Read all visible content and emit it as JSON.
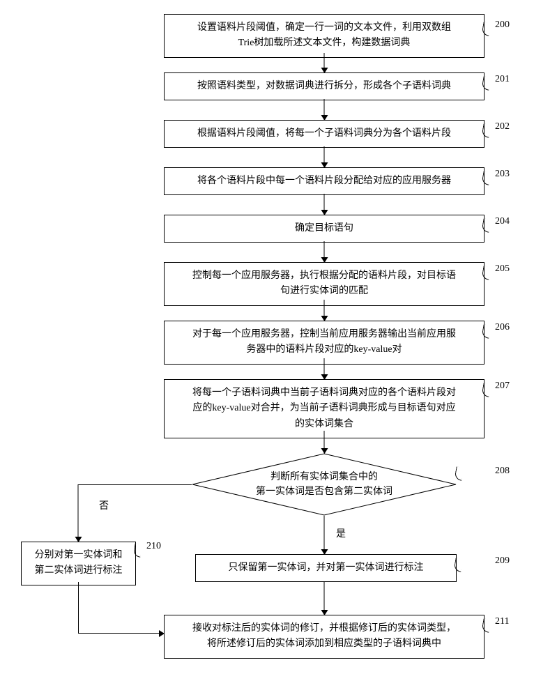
{
  "steps": {
    "s200": {
      "num": "200",
      "text": "设置语料片段阈值，确定一行一词的文本文件，利用双数组\nTrie树加载所述文本文件，构建数据词典"
    },
    "s201": {
      "num": "201",
      "text": "按照语料类型，对数据词典进行拆分，形成各个子语料词典"
    },
    "s202": {
      "num": "202",
      "text": "根据语料片段阈值，将每一个子语料词典分为各个语料片段"
    },
    "s203": {
      "num": "203",
      "text": "将各个语料片段中每一个语料片段分配给对应的应用服务器"
    },
    "s204": {
      "num": "204",
      "text": "确定目标语句"
    },
    "s205": {
      "num": "205",
      "text": "控制每一个应用服务器，执行根据分配的语料片段，对目标语\n句进行实体词的匹配"
    },
    "s206": {
      "num": "206",
      "text": "对于每一个应用服务器，控制当前应用服务器输出当前应用服\n务器中的语料片段对应的key-value对"
    },
    "s207": {
      "num": "207",
      "text": "将每一个子语料词典中当前子语料词典对应的各个语料片段对\n应的key-value对合并，为当前子语料词典形成与目标语句对应\n的实体词集合"
    },
    "s208": {
      "num": "208",
      "text": "判断所有实体词集合中的\n第一实体词是否包含第二实体词"
    },
    "s209": {
      "num": "209",
      "text": "只保留第一实体词，并对第一实体词进行标注"
    },
    "s210": {
      "num": "210",
      "text": "分别对第一实体词和\n第二实体词进行标注"
    },
    "s211": {
      "num": "211",
      "text": "接收对标注后的实体词的修订，并根据修订后的实体词类型，\n将所述修订后的实体词添加到相应类型的子语料词典中"
    }
  },
  "edges": {
    "no": "否",
    "yes": "是"
  }
}
